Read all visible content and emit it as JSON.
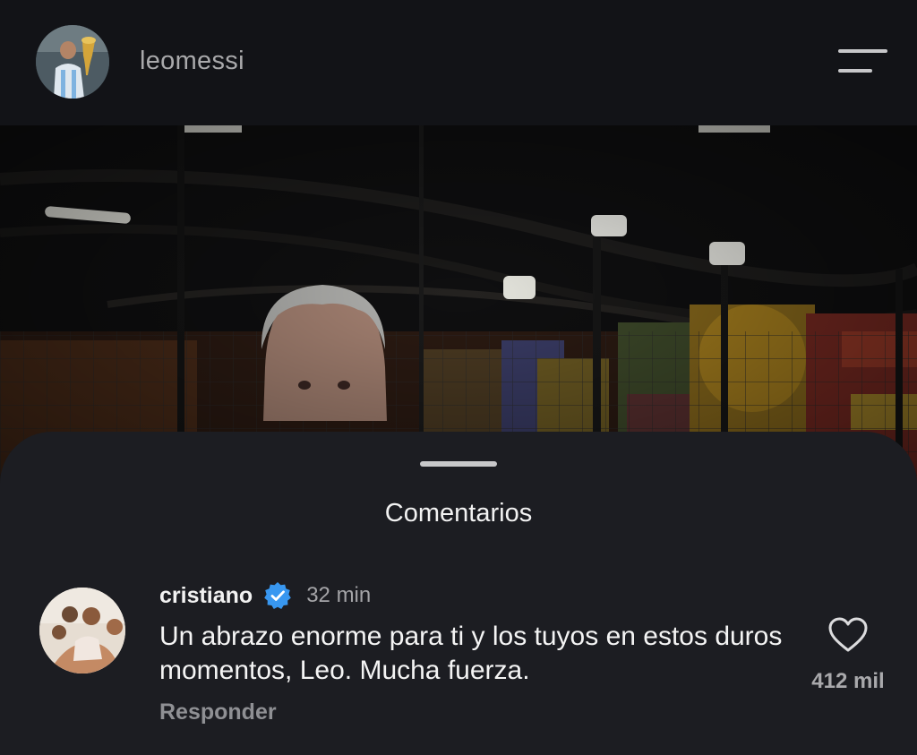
{
  "header": {
    "username": "leomessi",
    "avatar_icon": "profile-avatar",
    "menu_icon": "hamburger-menu-icon"
  },
  "post": {
    "image_icon": "post-photo"
  },
  "comments_sheet": {
    "title": "Comentarios",
    "comment": {
      "username": "cristiano",
      "verified": true,
      "time": "32 min",
      "text": "Un abrazo enorme para ti y los tuyos en estos duros momentos, Leo. Mucha fuerza.",
      "reply_label": "Responder",
      "like_count": "412 mil",
      "like_icon": "heart-icon"
    }
  },
  "colors": {
    "background": "#131418",
    "sheet": "#1c1d22",
    "verified": "#3897f0",
    "muted_text": "#a4a4a7"
  }
}
